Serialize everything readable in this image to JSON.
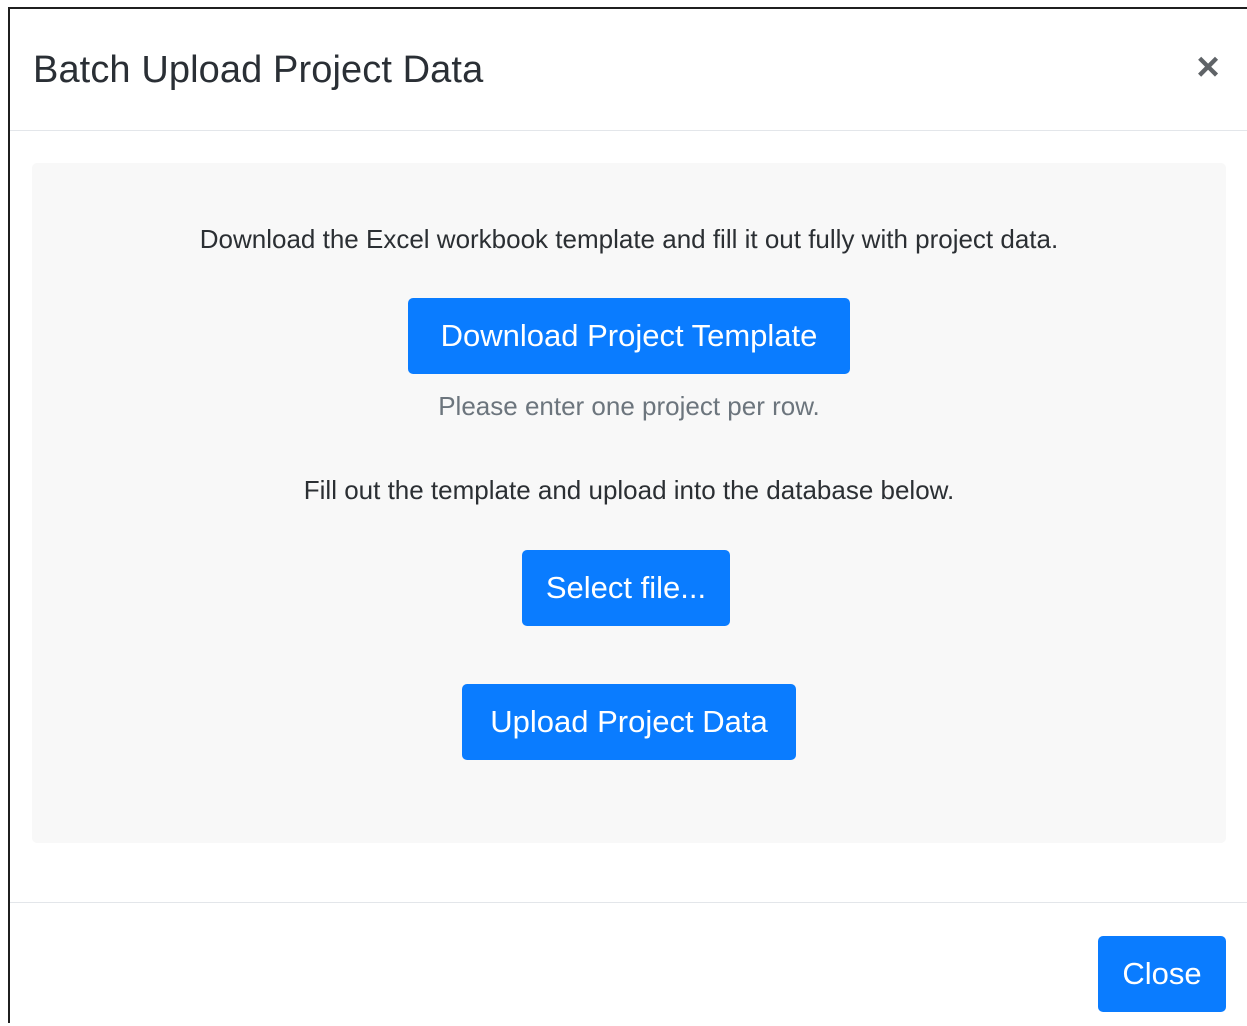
{
  "modal": {
    "title": "Batch Upload Project Data",
    "close_icon": "×"
  },
  "panel": {
    "instruction_1": "Download the Excel workbook template and fill it out fully with project data.",
    "download_button": "Download Project Template",
    "hint": "Please enter one project per row.",
    "instruction_2": "Fill out the template and upload into the database below.",
    "select_file_button": "Select file...",
    "upload_button": "Upload Project Data"
  },
  "footer": {
    "close_button": "Close"
  },
  "colors": {
    "primary": "#0a7cff",
    "panel_bg": "#f8f8f8",
    "muted_text": "#6c757d"
  }
}
